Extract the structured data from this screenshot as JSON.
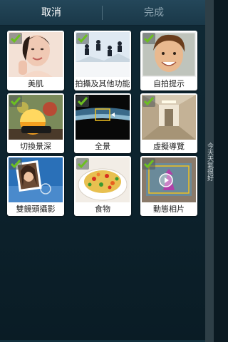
{
  "topbar": {
    "cancel_label": "取消",
    "done_label": "完成"
  },
  "tiles": [
    {
      "label": "美肌",
      "icon": "beauty-face-thumb",
      "checked": true
    },
    {
      "label": "拍攝及其他功能",
      "icon": "shot-and-more-thumb",
      "checked": true
    },
    {
      "label": "自拍提示",
      "icon": "selfie-alarm-thumb",
      "checked": true
    },
    {
      "label": "切換景深",
      "icon": "selective-focus-thumb",
      "checked": true
    },
    {
      "label": "全景",
      "icon": "panorama-thumb",
      "checked": true
    },
    {
      "label": "虛擬導覽",
      "icon": "virtual-tour-thumb",
      "checked": true
    },
    {
      "label": "雙鏡頭攝影",
      "icon": "dual-camera-thumb",
      "checked": true
    },
    {
      "label": "食物",
      "icon": "food-thumb",
      "checked": true
    },
    {
      "label": "動態相片",
      "icon": "animated-photo-thumb",
      "checked": true
    }
  ],
  "side_label": "今天天氣很好",
  "colors": {
    "check": "#6cc020",
    "topbar": "#24475a",
    "disabled_text": "#8fa6b2"
  }
}
